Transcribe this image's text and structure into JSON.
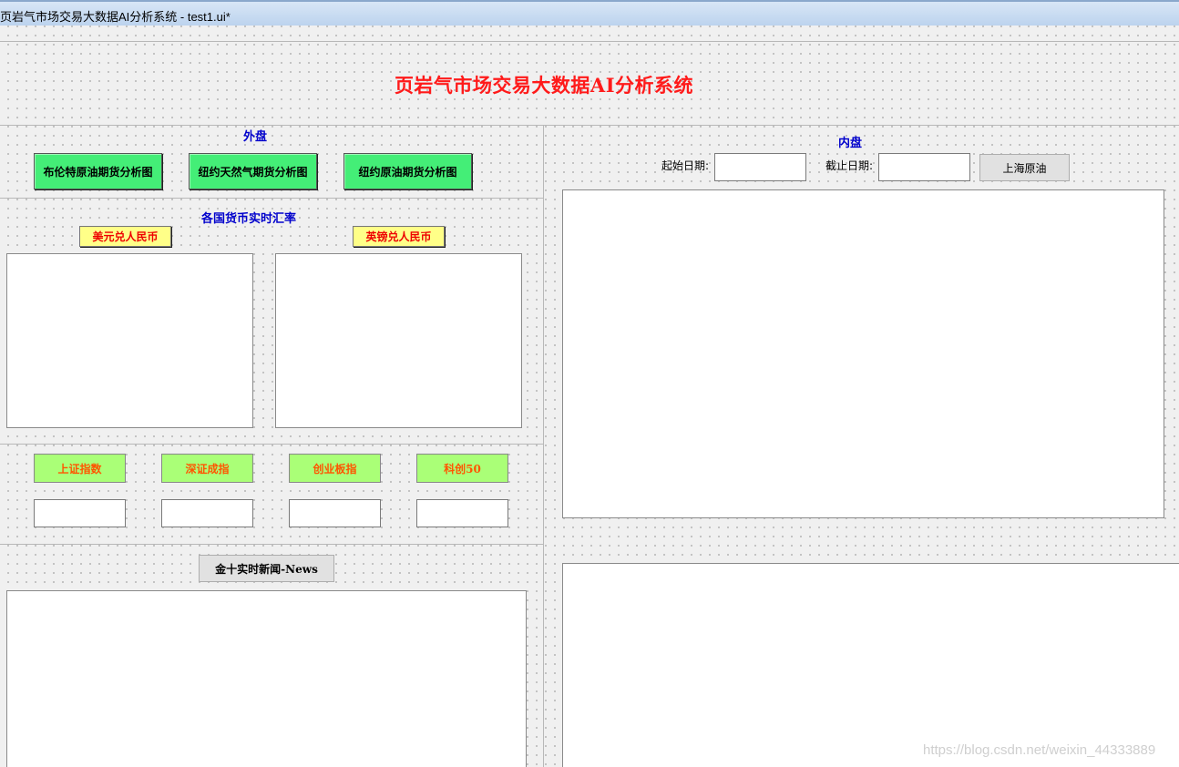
{
  "window": {
    "title": "页岩气市场交易大数据AI分析系统 - test1.ui*"
  },
  "header": {
    "title": "页岩气市场交易大数据AI分析系统"
  },
  "foreign": {
    "label": "外盘",
    "buttons": [
      "布伦特原油期货分析图",
      "纽约天然气期货分析图",
      "纽约原油期货分析图"
    ]
  },
  "currency": {
    "label": "各国货币实时汇率",
    "usd_label": "美元兑人民币",
    "gbp_label": "英镑兑人民币"
  },
  "indices": {
    "buttons": [
      "上证指数",
      "深证成指",
      "创业板指",
      "科创50"
    ],
    "values": [
      "",
      "",
      "",
      ""
    ]
  },
  "news": {
    "button_label": "金十实时新闻-News"
  },
  "domestic": {
    "label": "内盘",
    "start_label": "起始日期:",
    "end_label": "截止日期:",
    "start_value": "",
    "end_value": "",
    "query_button": "上海原油"
  },
  "watermark": "https://blog.csdn.net/weixin_44333889",
  "colors": {
    "title_red": "#ff1a1a",
    "section_blue": "#0000cc",
    "green_button": "#44ee77",
    "yellow_button": "#ffff88",
    "lime_button": "#aaff77"
  }
}
